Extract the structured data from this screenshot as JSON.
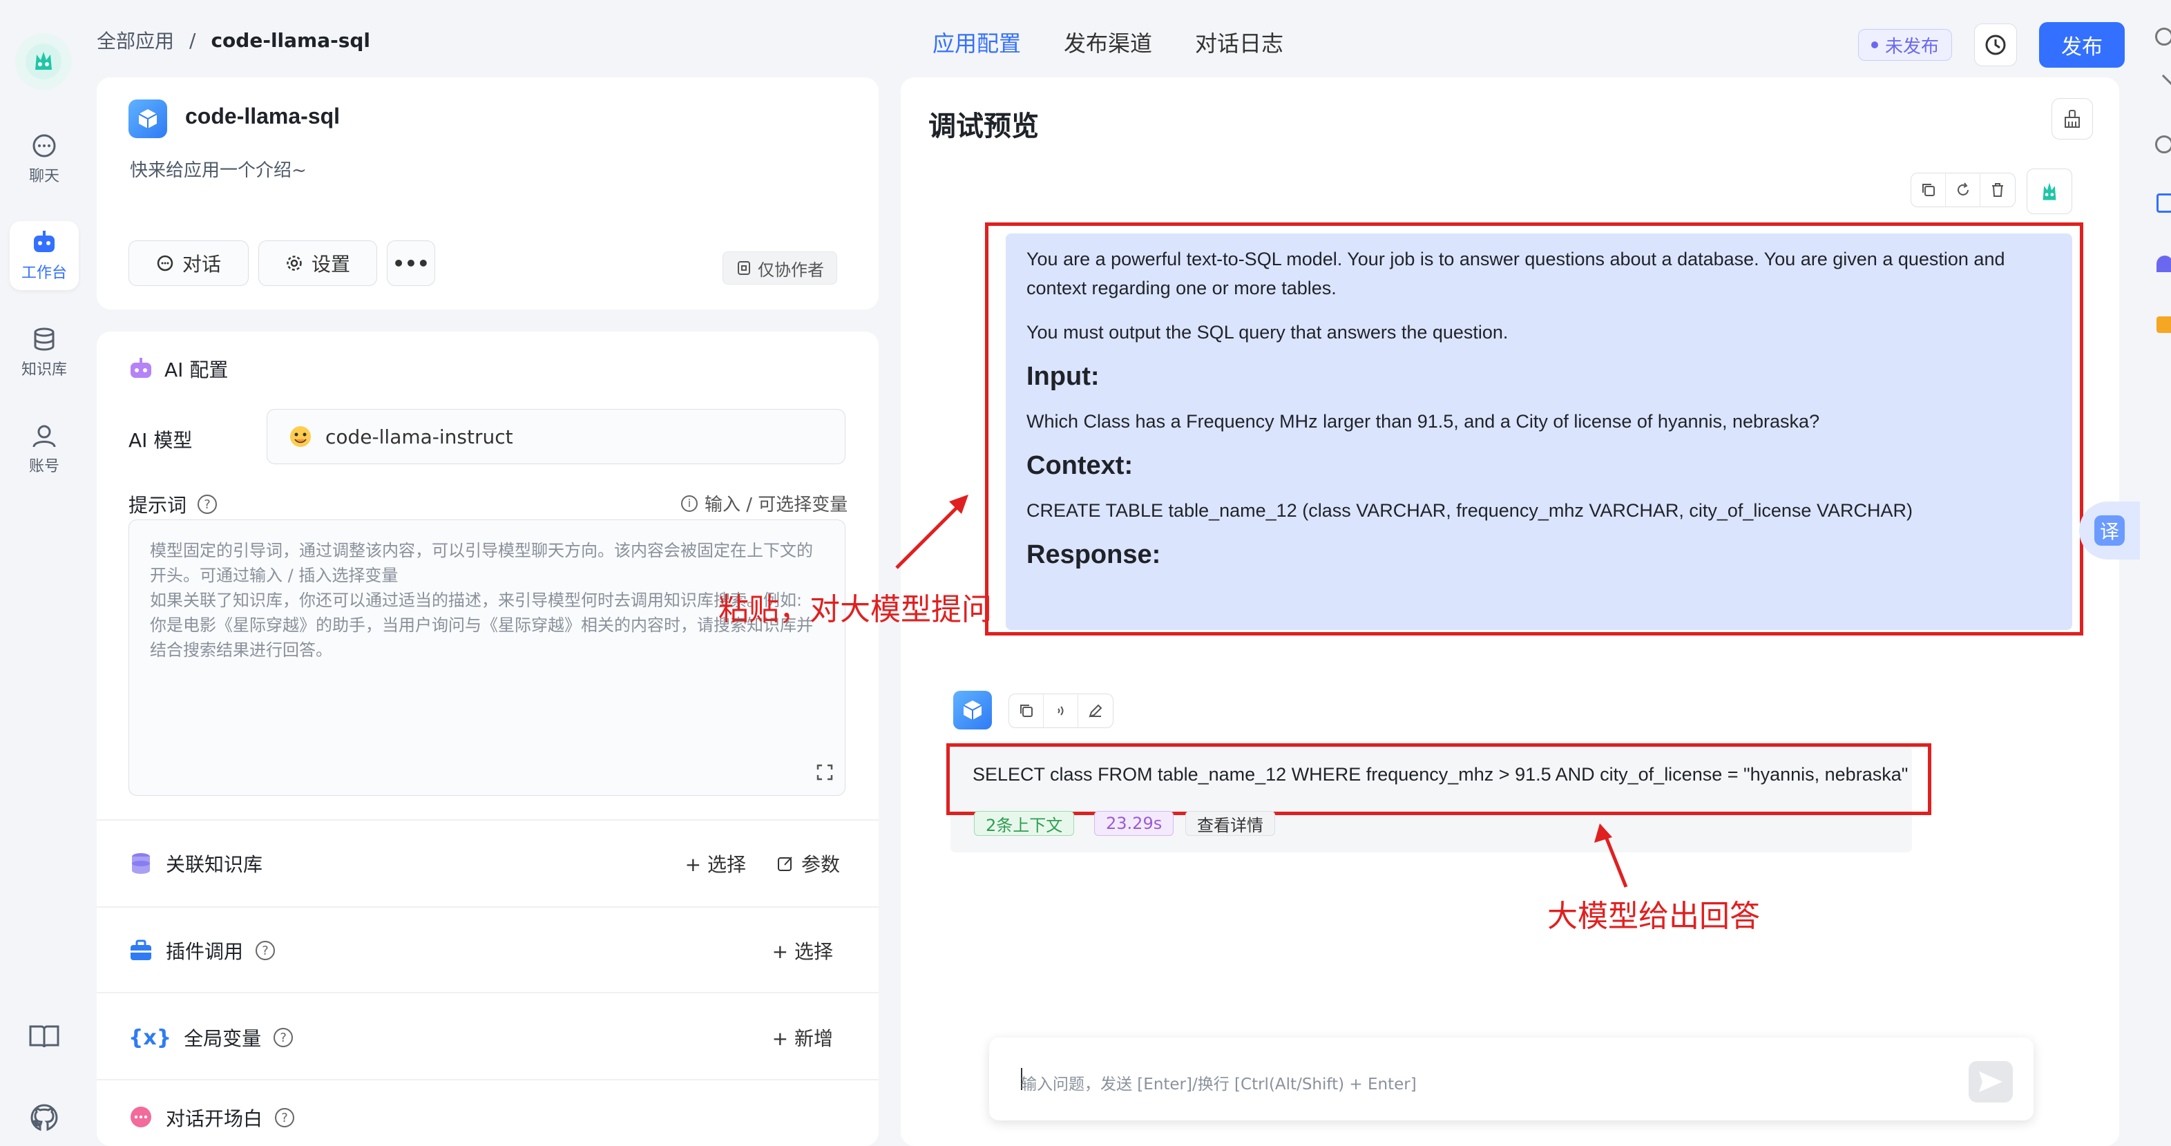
{
  "nav": {
    "items": [
      {
        "label": "聊天",
        "icon": "chat-icon"
      },
      {
        "label": "工作台",
        "icon": "robot-icon",
        "active": true
      },
      {
        "label": "知识库",
        "icon": "database-icon"
      },
      {
        "label": "账号",
        "icon": "user-icon"
      }
    ],
    "bottom_icons": [
      "book-icon",
      "github-icon"
    ]
  },
  "breadcrumb": {
    "root": "全部应用",
    "sep": "/",
    "current": "code-llama-sql"
  },
  "tabs": [
    "应用配置",
    "发布渠道",
    "对话日志"
  ],
  "header": {
    "status": "未发布",
    "publish": "发布"
  },
  "app": {
    "name": "code-llama-sql",
    "intro": "快来给应用一个介绍~",
    "btn_chat": "对话",
    "btn_settings": "设置",
    "btn_more": "•••",
    "collab": "仅协作者"
  },
  "ai_config": {
    "title": "AI 配置",
    "model_label": "AI 模型",
    "model_value": "code-llama-instruct",
    "prompt_label": "提示词",
    "prompt_hint": "输入 / 可选择变量",
    "prompt_placeholder_lines": [
      "模型固定的引导词，通过调整该内容，可以引导模型聊天方向。该内容会被固定在上下文的",
      "开头。可通过输入 / 插入选择变量",
      "如果关联了知识库，你还可以通过适当的描述，来引导模型何时去调用知识库搜索。例如:",
      "你是电影《星际穿越》的助手，当用户询问与《星际穿越》相关的内容时，请搜索知识库并",
      "结合搜索结果进行回答。"
    ]
  },
  "sections": {
    "kb": {
      "label": "关联知识库",
      "action1": "+ 选择",
      "action2": "参数"
    },
    "plugin": {
      "label": "插件调用",
      "action": "+ 选择"
    },
    "vars": {
      "label": "全局变量",
      "action": "+ 新增"
    },
    "opener": {
      "label": "对话开场白"
    }
  },
  "preview": {
    "title": "调试预览",
    "user_message": {
      "p1": "You are a powerful text-to-SQL model. Your job is to answer questions about a database. You are given a question and context regarding one or more tables.",
      "p2": "You must output the SQL query that answers the question.",
      "h_input": "Input:",
      "input": "Which Class has a Frequency MHz larger than 91.5, and a City of license of hyannis, nebraska?",
      "h_context": "Context:",
      "context": "CREATE TABLE table_name_12 (class VARCHAR, frequency_mhz VARCHAR, city_of_license VARCHAR)",
      "h_response": "Response:"
    },
    "answer": "SELECT class FROM table_name_12 WHERE frequency_mhz > 91.5 AND city_of_license = \"hyannis, nebraska\"",
    "tag_context": "2条上下文",
    "tag_time": "23.29s",
    "tag_detail": "查看详情",
    "input_placeholder": "输入问题，发送 [Enter]/换行 [Ctrl(Alt/Shift) + Enter]"
  },
  "annotations": {
    "paste": "粘贴，对大模型提问",
    "answer": "大模型给出回答"
  },
  "translate_label": "译",
  "colors": {
    "accent": "#3370ff",
    "annotation": "#e02020",
    "user_bubble": "#dbe4fd"
  }
}
